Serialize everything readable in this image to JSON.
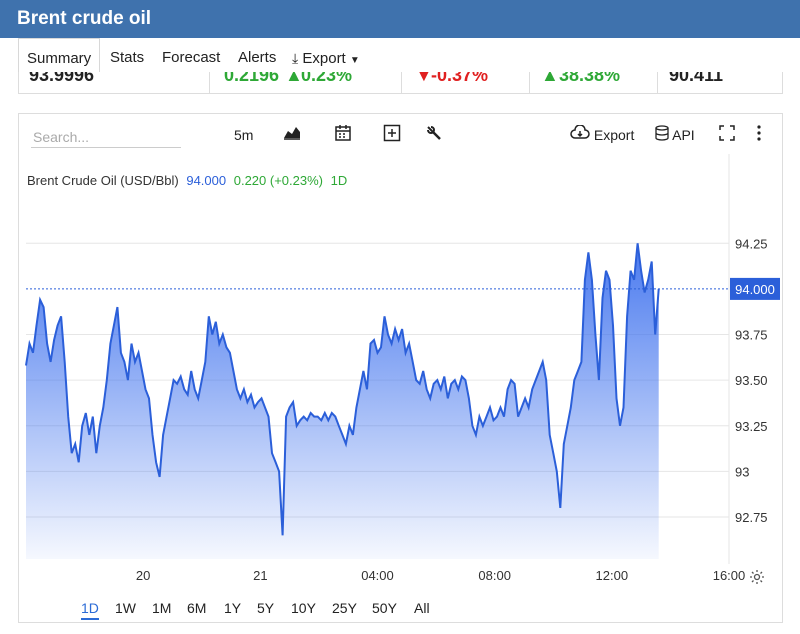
{
  "page": {
    "title": "Brent crude oil"
  },
  "tabs": [
    {
      "label": "Summary"
    },
    {
      "label": "Stats"
    },
    {
      "label": "Forecast"
    },
    {
      "label": "Alerts"
    },
    {
      "label": "Export"
    }
  ],
  "quote": {
    "price": "93.9996",
    "change": "0.2196",
    "change_pct": "0.23%",
    "cell3": "-0.37%",
    "cell4": "38.38%",
    "cell5": "90.411"
  },
  "toolbar": {
    "search_placeholder": "Search...",
    "interval": "5m",
    "export_label": "Export",
    "api_label": "API"
  },
  "legend": {
    "symbol": "Brent Crude Oil (USD/Bbl)",
    "price": "94.000",
    "change": "0.220 (+0.23%)",
    "period": "1D"
  },
  "colors": {
    "accent": "#3f72ad",
    "line": "#2b5fd9",
    "up": "#2ea836",
    "down": "#e02020",
    "price_tag": "#2b5fd9"
  },
  "ranges": [
    {
      "label": "1D",
      "active": true
    },
    {
      "label": "1W"
    },
    {
      "label": "1M"
    },
    {
      "label": "6M"
    },
    {
      "label": "1Y"
    },
    {
      "label": "5Y"
    },
    {
      "label": "10Y"
    },
    {
      "label": "25Y"
    },
    {
      "label": "50Y"
    },
    {
      "label": "All"
    }
  ],
  "chart_data": {
    "type": "area",
    "y_ticks": [
      {
        "value": 94.25,
        "label": "94.25"
      },
      {
        "value": 93.75,
        "label": "93.75"
      },
      {
        "value": 93.5,
        "label": "93.50"
      },
      {
        "value": 93.25,
        "label": "93.25"
      },
      {
        "value": 93.0,
        "label": "93"
      },
      {
        "value": 92.75,
        "label": "92.75"
      }
    ],
    "x_ticks": [
      {
        "x": 10,
        "label": "20"
      },
      {
        "x": 20,
        "label": "21"
      },
      {
        "x": 30,
        "label": "04:00"
      },
      {
        "x": 40,
        "label": "08:00"
      },
      {
        "x": 50,
        "label": "12:00"
      },
      {
        "x": 60,
        "label": "16:00"
      }
    ],
    "current_value": 94.0,
    "current_label": "94.000",
    "ylim": [
      92.52,
      94.52
    ],
    "xlim": [
      0,
      60
    ],
    "points": [
      [
        0,
        93.58
      ],
      [
        0.3,
        93.7
      ],
      [
        0.6,
        93.65
      ],
      [
        0.9,
        93.8
      ],
      [
        1.2,
        93.94
      ],
      [
        1.5,
        93.9
      ],
      [
        1.8,
        93.7
      ],
      [
        2.1,
        93.6
      ],
      [
        2.4,
        93.72
      ],
      [
        2.7,
        93.8
      ],
      [
        3.0,
        93.85
      ],
      [
        3.3,
        93.6
      ],
      [
        3.6,
        93.3
      ],
      [
        3.9,
        93.1
      ],
      [
        4.2,
        93.15
      ],
      [
        4.5,
        93.05
      ],
      [
        4.8,
        93.25
      ],
      [
        5.1,
        93.32
      ],
      [
        5.4,
        93.2
      ],
      [
        5.7,
        93.3
      ],
      [
        6.0,
        93.1
      ],
      [
        6.3,
        93.25
      ],
      [
        6.6,
        93.35
      ],
      [
        6.9,
        93.5
      ],
      [
        7.2,
        93.7
      ],
      [
        7.5,
        93.8
      ],
      [
        7.8,
        93.9
      ],
      [
        8.1,
        93.65
      ],
      [
        8.4,
        93.6
      ],
      [
        8.7,
        93.5
      ],
      [
        9.0,
        93.7
      ],
      [
        9.3,
        93.6
      ],
      [
        9.6,
        93.65
      ],
      [
        9.9,
        93.55
      ],
      [
        10.2,
        93.45
      ],
      [
        10.5,
        93.4
      ],
      [
        10.8,
        93.2
      ],
      [
        11.1,
        93.05
      ],
      [
        11.4,
        92.97
      ],
      [
        11.7,
        93.2
      ],
      [
        12.0,
        93.3
      ],
      [
        12.3,
        93.4
      ],
      [
        12.6,
        93.5
      ],
      [
        12.9,
        93.48
      ],
      [
        13.2,
        93.52
      ],
      [
        13.5,
        93.45
      ],
      [
        13.8,
        93.42
      ],
      [
        14.1,
        93.55
      ],
      [
        14.4,
        93.45
      ],
      [
        14.7,
        93.4
      ],
      [
        15.0,
        93.5
      ],
      [
        15.3,
        93.6
      ],
      [
        15.6,
        93.85
      ],
      [
        15.9,
        93.75
      ],
      [
        16.2,
        93.82
      ],
      [
        16.5,
        93.7
      ],
      [
        16.8,
        93.75
      ],
      [
        17.1,
        93.68
      ],
      [
        17.4,
        93.65
      ],
      [
        17.7,
        93.55
      ],
      [
        18.0,
        93.45
      ],
      [
        18.3,
        93.4
      ],
      [
        18.6,
        93.45
      ],
      [
        18.9,
        93.38
      ],
      [
        19.2,
        93.42
      ],
      [
        19.5,
        93.35
      ],
      [
        19.8,
        93.38
      ],
      [
        20.1,
        93.4
      ],
      [
        20.4,
        93.35
      ],
      [
        20.7,
        93.3
      ],
      [
        21.0,
        93.1
      ],
      [
        21.3,
        93.05
      ],
      [
        21.6,
        93.0
      ],
      [
        21.9,
        92.65
      ],
      [
        22.2,
        93.3
      ],
      [
        22.5,
        93.35
      ],
      [
        22.8,
        93.38
      ],
      [
        23.1,
        93.25
      ],
      [
        23.4,
        93.28
      ],
      [
        23.7,
        93.3
      ],
      [
        24.0,
        93.28
      ],
      [
        24.3,
        93.32
      ],
      [
        24.6,
        93.3
      ],
      [
        24.9,
        93.3
      ],
      [
        25.2,
        93.28
      ],
      [
        25.5,
        93.32
      ],
      [
        25.8,
        93.28
      ],
      [
        26.1,
        93.32
      ],
      [
        26.4,
        93.3
      ],
      [
        26.7,
        93.25
      ],
      [
        27.0,
        93.2
      ],
      [
        27.3,
        93.15
      ],
      [
        27.6,
        93.25
      ],
      [
        27.9,
        93.2
      ],
      [
        28.2,
        93.35
      ],
      [
        28.5,
        93.45
      ],
      [
        28.8,
        93.55
      ],
      [
        29.1,
        93.45
      ],
      [
        29.4,
        93.7
      ],
      [
        29.7,
        93.72
      ],
      [
        30.0,
        93.65
      ],
      [
        30.3,
        93.68
      ],
      [
        30.6,
        93.85
      ],
      [
        30.9,
        93.75
      ],
      [
        31.2,
        93.7
      ],
      [
        31.5,
        93.78
      ],
      [
        31.8,
        93.72
      ],
      [
        32.1,
        93.78
      ],
      [
        32.4,
        93.65
      ],
      [
        32.7,
        93.7
      ],
      [
        33.0,
        93.6
      ],
      [
        33.3,
        93.5
      ],
      [
        33.6,
        93.48
      ],
      [
        33.9,
        93.55
      ],
      [
        34.2,
        93.45
      ],
      [
        34.5,
        93.4
      ],
      [
        34.8,
        93.48
      ],
      [
        35.1,
        93.5
      ],
      [
        35.4,
        93.45
      ],
      [
        35.7,
        93.52
      ],
      [
        36.0,
        93.4
      ],
      [
        36.3,
        93.48
      ],
      [
        36.6,
        93.5
      ],
      [
        36.9,
        93.45
      ],
      [
        37.2,
        93.52
      ],
      [
        37.5,
        93.5
      ],
      [
        37.8,
        93.4
      ],
      [
        38.1,
        93.25
      ],
      [
        38.4,
        93.2
      ],
      [
        38.7,
        93.3
      ],
      [
        39.0,
        93.25
      ],
      [
        39.3,
        93.3
      ],
      [
        39.6,
        93.35
      ],
      [
        39.9,
        93.28
      ],
      [
        40.2,
        93.3
      ],
      [
        40.5,
        93.35
      ],
      [
        40.8,
        93.3
      ],
      [
        41.1,
        93.45
      ],
      [
        41.4,
        93.5
      ],
      [
        41.7,
        93.48
      ],
      [
        42.0,
        93.3
      ],
      [
        42.3,
        93.35
      ],
      [
        42.6,
        93.4
      ],
      [
        42.9,
        93.35
      ],
      [
        43.2,
        93.45
      ],
      [
        43.5,
        93.5
      ],
      [
        43.8,
        93.55
      ],
      [
        44.1,
        93.6
      ],
      [
        44.4,
        93.5
      ],
      [
        44.7,
        93.2
      ],
      [
        45.0,
        93.1
      ],
      [
        45.3,
        93.0
      ],
      [
        45.6,
        92.8
      ],
      [
        45.9,
        93.15
      ],
      [
        46.2,
        93.25
      ],
      [
        46.5,
        93.35
      ],
      [
        46.8,
        93.5
      ],
      [
        47.1,
        93.55
      ],
      [
        47.4,
        93.6
      ],
      [
        47.7,
        94.05
      ],
      [
        48.0,
        94.2
      ],
      [
        48.3,
        94.05
      ],
      [
        48.6,
        93.75
      ],
      [
        48.9,
        93.5
      ],
      [
        49.2,
        93.95
      ],
      [
        49.5,
        94.1
      ],
      [
        49.8,
        94.05
      ],
      [
        50.1,
        93.8
      ],
      [
        50.4,
        93.4
      ],
      [
        50.7,
        93.25
      ],
      [
        51.0,
        93.35
      ],
      [
        51.3,
        93.85
      ],
      [
        51.6,
        94.1
      ],
      [
        51.9,
        94.05
      ],
      [
        52.2,
        94.25
      ],
      [
        52.5,
        94.1
      ],
      [
        52.8,
        93.98
      ],
      [
        53.1,
        94.05
      ],
      [
        53.4,
        94.15
      ],
      [
        53.7,
        93.75
      ],
      [
        54.0,
        94.0
      ]
    ]
  }
}
